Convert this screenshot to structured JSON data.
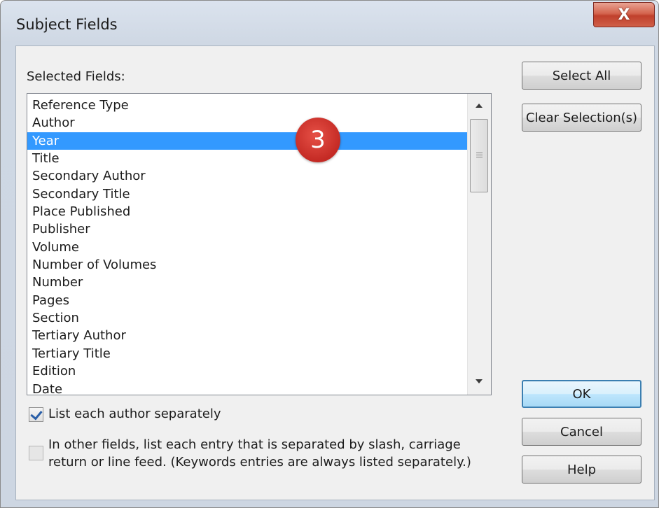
{
  "window": {
    "title": "Subject Fields",
    "close_glyph": "X"
  },
  "list": {
    "label": "Selected Fields:",
    "items": [
      {
        "label": "Reference Type",
        "selected": false
      },
      {
        "label": "Author",
        "selected": false
      },
      {
        "label": "Year",
        "selected": true
      },
      {
        "label": "Title",
        "selected": false
      },
      {
        "label": "Secondary Author",
        "selected": false
      },
      {
        "label": "Secondary Title",
        "selected": false
      },
      {
        "label": "Place Published",
        "selected": false
      },
      {
        "label": "Publisher",
        "selected": false
      },
      {
        "label": "Volume",
        "selected": false
      },
      {
        "label": "Number of Volumes",
        "selected": false
      },
      {
        "label": "Number",
        "selected": false
      },
      {
        "label": "Pages",
        "selected": false
      },
      {
        "label": "Section",
        "selected": false
      },
      {
        "label": "Tertiary Author",
        "selected": false
      },
      {
        "label": "Tertiary Title",
        "selected": false
      },
      {
        "label": "Edition",
        "selected": false
      },
      {
        "label": "Date",
        "selected": false
      }
    ]
  },
  "annotation": {
    "step": "3"
  },
  "buttons": {
    "select_all": "Select All",
    "clear_selection": "Clear Selection(s)",
    "ok": "OK",
    "cancel": "Cancel",
    "help": "Help"
  },
  "options": {
    "list_authors_separately": {
      "label": "List each author separately",
      "checked": true
    },
    "list_entries_separately": {
      "line1": "In other fields, list each entry that is separated by slash, carriage",
      "line2": "return or line feed. (Keywords entries are always listed separately.)",
      "checked": false,
      "enabled": false
    }
  },
  "colors": {
    "selection": "#3399ff",
    "badge": "#d33a32",
    "close": "#c9503a"
  },
  "icons": [
    "close-icon",
    "scroll-up-arrow-icon",
    "scroll-down-arrow-icon",
    "checkmark-icon"
  ]
}
